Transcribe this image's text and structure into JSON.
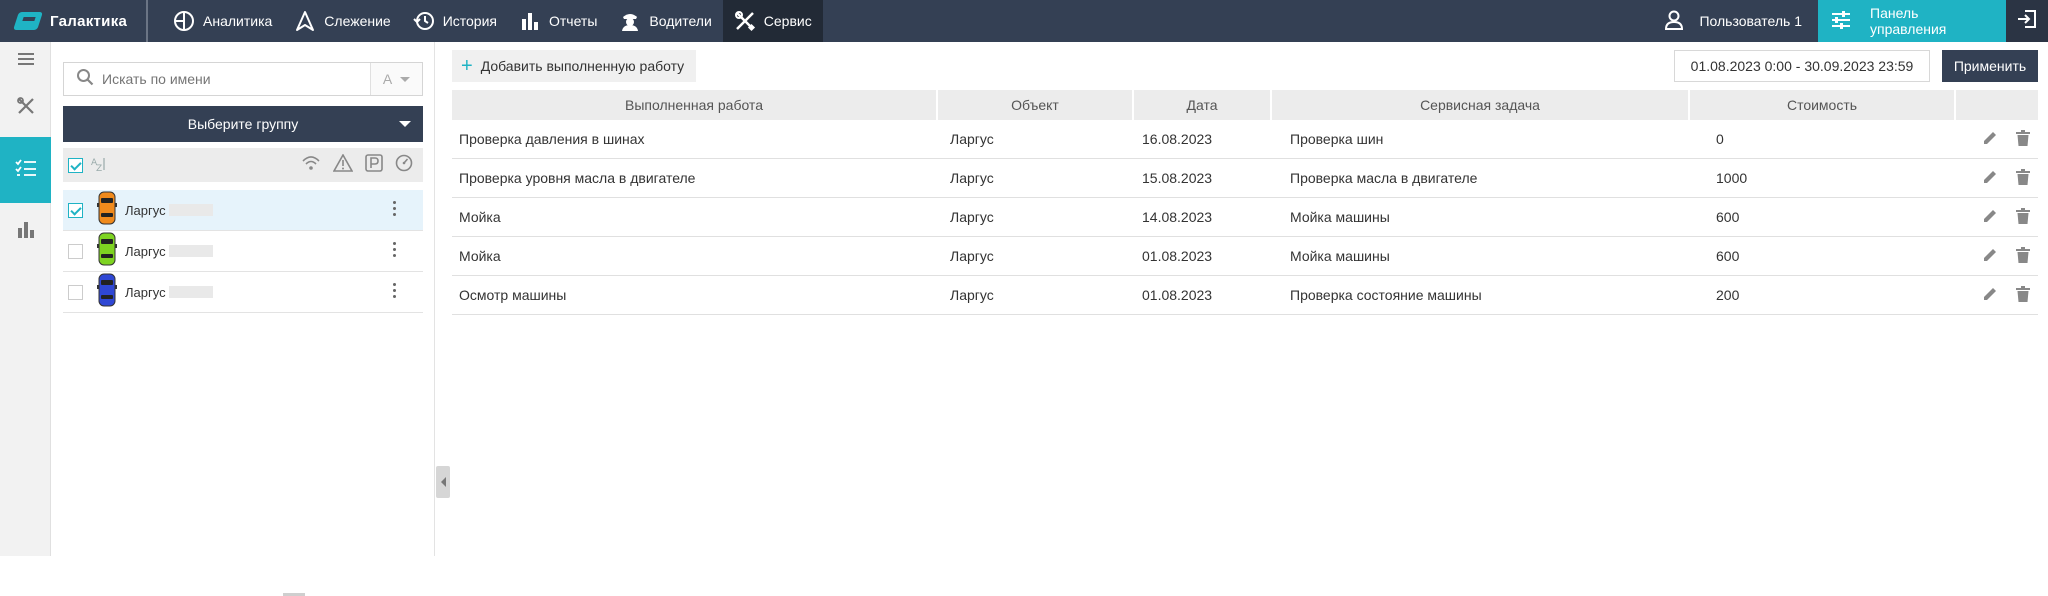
{
  "app": {
    "brand": "Галактика"
  },
  "nav": {
    "items": [
      {
        "label": "Аналитика",
        "icon": "analytics-icon"
      },
      {
        "label": "Слежение",
        "icon": "tracking-icon"
      },
      {
        "label": "История",
        "icon": "history-icon"
      },
      {
        "label": "Отчеты",
        "icon": "reports-icon"
      },
      {
        "label": "Водители",
        "icon": "driver-icon"
      },
      {
        "label": "Сервис",
        "icon": "service-tools-icon",
        "active": true
      }
    ],
    "user_label": "Пользователь 1",
    "panel_label": "Панель управления"
  },
  "objects": {
    "search_placeholder": "Искать по имени",
    "sort_label": "А",
    "group_label": "Выберите группу",
    "items": [
      {
        "name": "Ларгус",
        "color": "#f08a1c",
        "checked": true
      },
      {
        "name": "Ларгус",
        "color": "#7ed321",
        "checked": false
      },
      {
        "name": "Ларгус",
        "color": "#2f47d4",
        "checked": false
      }
    ]
  },
  "toolbar": {
    "add_label": "Добавить выполненную работу",
    "date_range": "01.08.2023 0:00 - 30.09.2023 23:59",
    "apply_label": "Применить"
  },
  "table": {
    "headers": [
      "Выполненная работа",
      "Объект",
      "Дата",
      "Сервисная задача",
      "Стоимость"
    ],
    "rows": [
      {
        "work": "Проверка давления в шинах",
        "object": "Ларгус",
        "date": "16.08.2023",
        "task": "Проверка шин",
        "cost": "0"
      },
      {
        "work": "Проверка уровня масла в двигателе",
        "object": "Ларгус",
        "date": "15.08.2023",
        "task": "Проверка масла в двигателе",
        "cost": "1000"
      },
      {
        "work": "Мойка",
        "object": "Ларгус",
        "date": "14.08.2023",
        "task": "Мойка машины",
        "cost": "600"
      },
      {
        "work": "Мойка",
        "object": "Ларгус",
        "date": "01.08.2023",
        "task": "Мойка машины",
        "cost": "600"
      },
      {
        "work": "Осмотр машины",
        "object": "Ларгус",
        "date": "01.08.2023",
        "task": "Проверка состояние машины",
        "cost": "200"
      }
    ]
  },
  "colors": {
    "accent": "#1fb3c4",
    "topbar": "#344054"
  }
}
